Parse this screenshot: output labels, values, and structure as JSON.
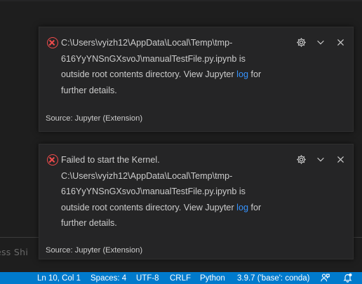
{
  "notifications": [
    {
      "severity_icon": "error-icon",
      "message_text": "C:\\Users\\vyizh12\\AppData\\Local\\Temp\\tmp-616YyYNSnGXsvoJ\\manualTestFile.py.ipynb is outside root contents directory. View Jupyter",
      "message_link": "log",
      "message_tail": "for further details.",
      "source": "Source: Jupyter (Extension)",
      "actions": [
        "gear-icon",
        "chevron-down-icon",
        "close-icon"
      ]
    },
    {
      "severity_icon": "error-icon",
      "message_text": "Failed to start the Kernel. C:\\Users\\vyizh12\\AppData\\Local\\Temp\\tmp-616YyYNSnGXsvoJ\\manualTestFile.py.ipynb is outside root contents directory. View Jupyter",
      "message_link": "log",
      "message_tail": "for further details.",
      "source": "Source: Jupyter (Extension)",
      "actions": [
        "gear-icon",
        "chevron-down-icon",
        "close-icon"
      ]
    }
  ],
  "input_box": {
    "placeholder": "ess Shi"
  },
  "statusbar": {
    "cursor_position": "Ln 10, Col 1",
    "indentation": "Spaces: 4",
    "encoding": "UTF-8",
    "line_ending": "CRLF",
    "language": "Python",
    "interpreter": "3.9.7 ('base': conda)",
    "feedback_icon": "feedback-icon",
    "notifications_icon": "bell-icon"
  },
  "colors": {
    "statusbar_bg": "#007acc",
    "error": "#f14c4c",
    "link": "#3794ff",
    "toast_bg": "#252526"
  }
}
